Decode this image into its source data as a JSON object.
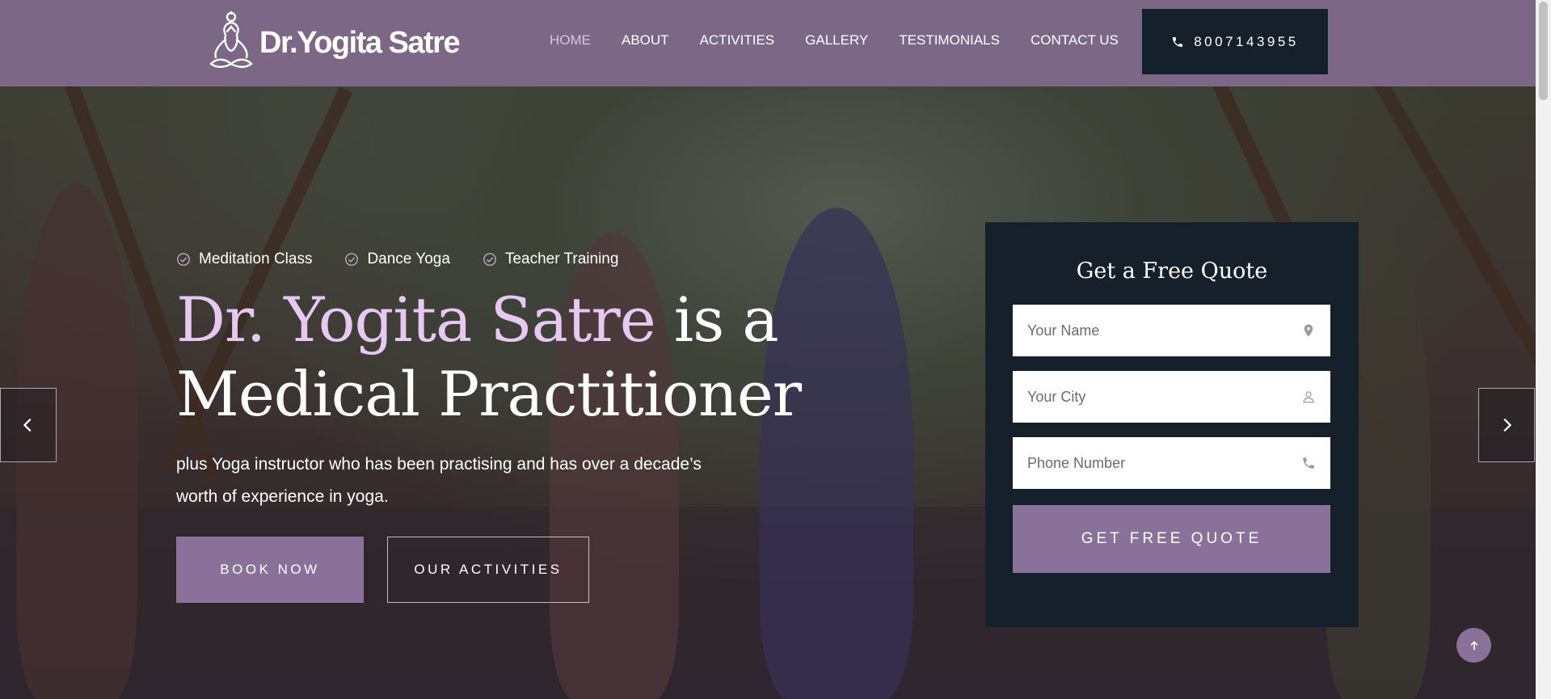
{
  "header": {
    "logo_text": "Dr.Yogita Satre",
    "nav": [
      "HOME",
      "ABOUT",
      "ACTIVITIES",
      "GALLERY",
      "TESTIMONIALS",
      "CONTACT US"
    ],
    "phone": "8007143955"
  },
  "hero": {
    "tags": [
      "Meditation Class",
      "Dance Yoga",
      "Teacher Training"
    ],
    "headline_highlight": "Dr. Yogita Satre",
    "headline_rest_1": " is a",
    "headline_rest_2": "Medical Practitioner",
    "subtext": "plus Yoga instructor who has been practising and has over a decade’s worth of experience in yoga.",
    "book_label": "BOOK NOW",
    "activities_label": "OUR ACTIVITIES"
  },
  "quote_form": {
    "title": "Get a Free Quote",
    "name_placeholder": "Your Name",
    "city_placeholder": "Your City",
    "phone_placeholder": "Phone Number",
    "submit_label": "GET FREE QUOTE"
  },
  "colors": {
    "header_bg": "#7c6787",
    "accent": "#8a719a",
    "dark": "#16202a",
    "highlight_text": "#e7c8f2"
  },
  "icons": [
    "yoga-logo-icon",
    "phone-icon",
    "check-circle-icon",
    "map-pin-icon",
    "user-icon",
    "chevron-left-icon",
    "chevron-right-icon",
    "arrow-up-icon"
  ]
}
